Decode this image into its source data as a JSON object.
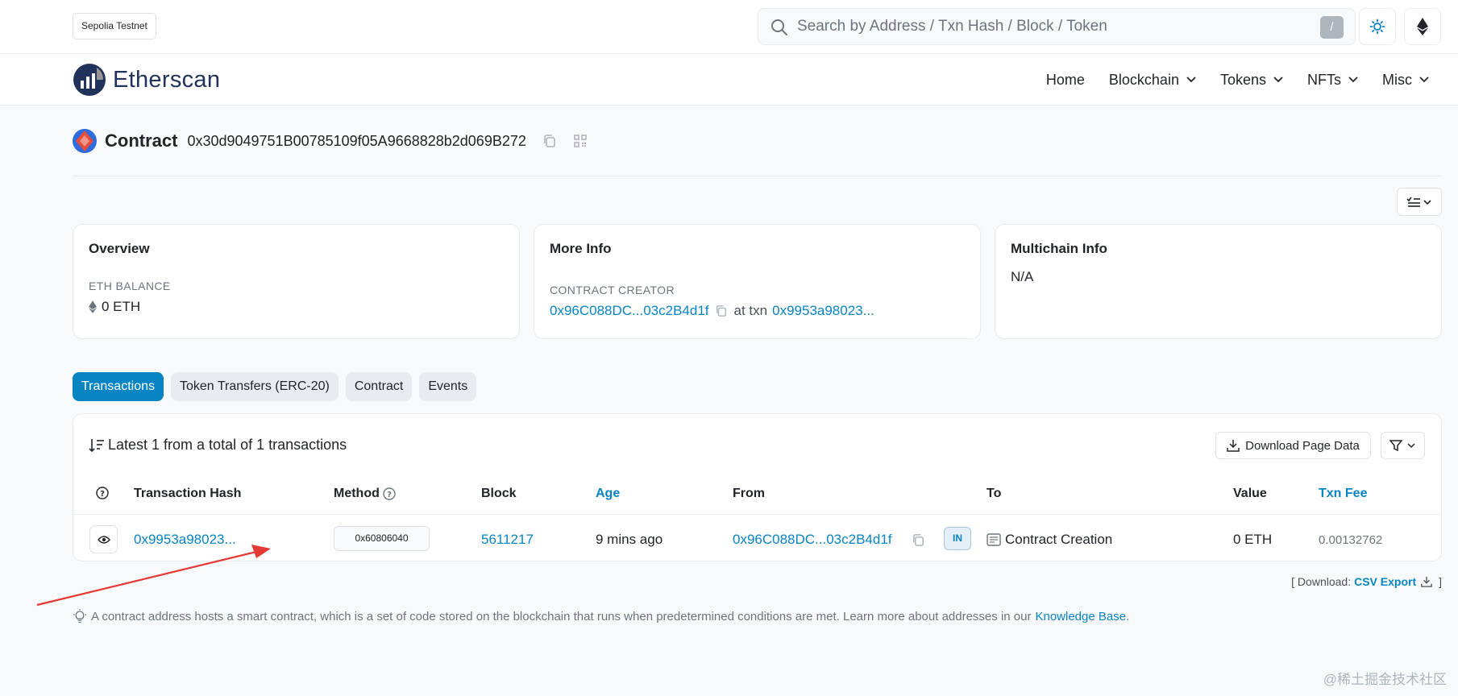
{
  "network": "Sepolia Testnet",
  "search": {
    "placeholder": "Search by Address / Txn Hash / Block / Token",
    "shortcut": "/"
  },
  "brand": {
    "name": "Etherscan"
  },
  "nav": {
    "home": "Home",
    "blockchain": "Blockchain",
    "tokens": "Tokens",
    "nfts": "NFTs",
    "misc": "Misc"
  },
  "contract": {
    "label": "Contract",
    "address": "0x30d9049751B00785109f05A9668828b2d069B272"
  },
  "overview": {
    "title": "Overview",
    "balance_label": "ETH BALANCE",
    "balance_value": "0 ETH"
  },
  "more_info": {
    "title": "More Info",
    "creator_label": "CONTRACT CREATOR",
    "creator_address": "0x96C088DC...03c2B4d1f",
    "at_txn": "at txn",
    "creator_txn": "0x9953a98023..."
  },
  "multichain": {
    "title": "Multichain Info",
    "value": "N/A"
  },
  "tabs": [
    {
      "label": "Transactions",
      "active": true
    },
    {
      "label": "Token Transfers (ERC-20)",
      "active": false
    },
    {
      "label": "Contract",
      "active": false
    },
    {
      "label": "Events",
      "active": false
    }
  ],
  "transactions": {
    "summary": "Latest 1 from a total of 1 transactions",
    "download_label": "Download Page Data",
    "columns": {
      "hash": "Transaction Hash",
      "method": "Method",
      "block": "Block",
      "age": "Age",
      "from": "From",
      "to": "To",
      "value": "Value",
      "fee": "Txn Fee"
    },
    "rows": [
      {
        "hash": "0x9953a98023...",
        "method": "0x60806040",
        "block": "5611217",
        "age": "9 mins ago",
        "from": "0x96C088DC...03c2B4d1f",
        "direction": "IN",
        "to": "Contract Creation",
        "value": "0 ETH",
        "fee": "0.00132762"
      }
    ]
  },
  "csv": {
    "prefix": "[ Download:",
    "link": "CSV Export",
    "suffix": "]"
  },
  "footnote": {
    "text": "A contract address hosts a smart contract, which is a set of code stored on the blockchain that runs when predetermined conditions are met. Learn more about addresses in our",
    "link": "Knowledge Base",
    "end": "."
  },
  "watermark": "@稀土掘金技术社区",
  "colors": {
    "accent": "#0784c3",
    "annotation_arrow": "#e53935"
  }
}
